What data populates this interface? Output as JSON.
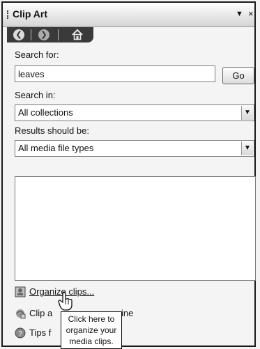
{
  "panel": {
    "title": "Clip Art"
  },
  "search": {
    "label": "Search for:",
    "value": "leaves",
    "go_label": "Go"
  },
  "search_in": {
    "label": "Search in:",
    "value": "All collections"
  },
  "results_type": {
    "label": "Results should be:",
    "value": "All media file types"
  },
  "links": [
    {
      "text": "Organize clips..."
    },
    {
      "text_left": "Clip a",
      "text_right": "ine"
    },
    {
      "text_left": "Tips f"
    }
  ],
  "tooltip": {
    "line1": "Click here to",
    "line2": "organize your",
    "line3": "media clips."
  }
}
